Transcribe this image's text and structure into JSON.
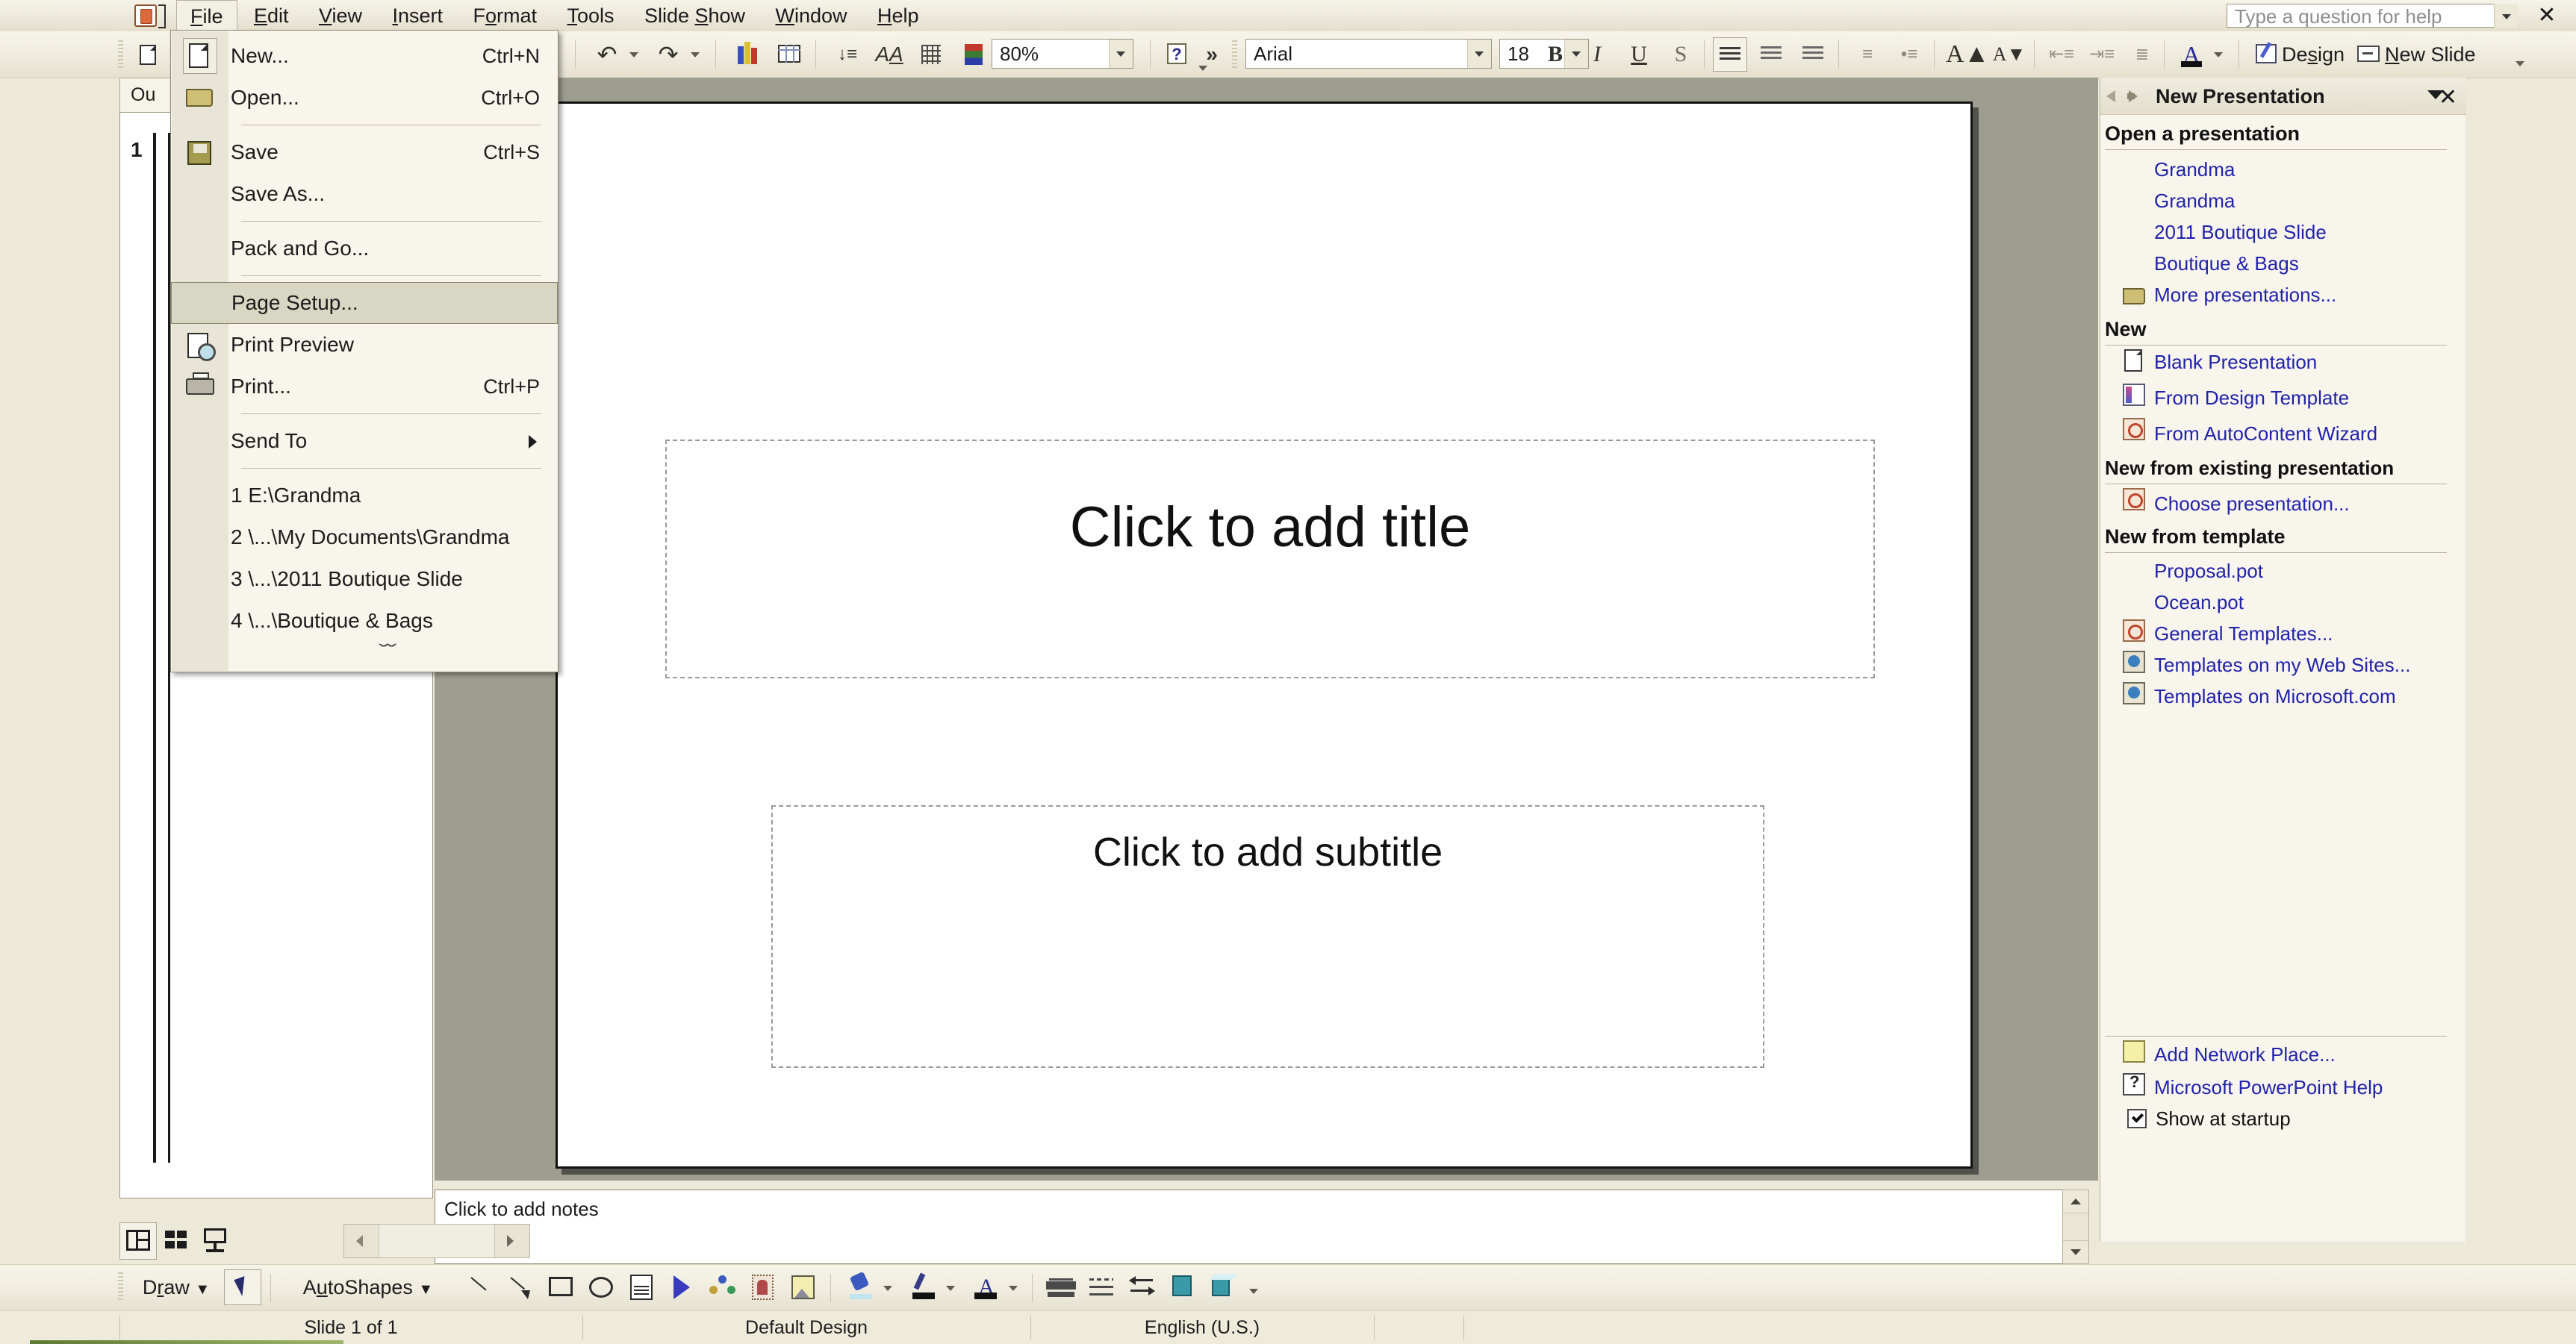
{
  "app": {
    "help_placeholder": "Type a question for help",
    "close_label": "✕"
  },
  "menubar": {
    "items": [
      {
        "label": "File",
        "accel": "F",
        "open": true
      },
      {
        "label": "Edit",
        "accel": "E",
        "open": false
      },
      {
        "label": "View",
        "accel": "V",
        "open": false
      },
      {
        "label": "Insert",
        "accel": "I",
        "open": false
      },
      {
        "label": "Format",
        "accel": "o",
        "open": false
      },
      {
        "label": "Tools",
        "accel": "T",
        "open": false
      },
      {
        "label": "Slide Show",
        "accel": "S",
        "open": false
      },
      {
        "label": "Window",
        "accel": "W",
        "open": false
      },
      {
        "label": "Help",
        "accel": "H",
        "open": false
      }
    ]
  },
  "file_menu": {
    "items": [
      {
        "label": "New...",
        "accel": "Ctrl+N",
        "icon": "new-document-icon",
        "type": "item"
      },
      {
        "label": "Open...",
        "accel": "Ctrl+O",
        "icon": "open-folder-icon",
        "type": "item"
      },
      {
        "type": "separator"
      },
      {
        "label": "Save",
        "accel": "Ctrl+S",
        "icon": "floppy-disk-icon",
        "type": "item"
      },
      {
        "label": "Save As...",
        "accel": "",
        "icon": "",
        "type": "item"
      },
      {
        "type": "separator"
      },
      {
        "label": "Pack and Go...",
        "accel": "",
        "icon": "",
        "type": "item"
      },
      {
        "type": "separator"
      },
      {
        "label": "Page Setup...",
        "accel": "",
        "icon": "",
        "type": "item",
        "highlighted": true
      },
      {
        "label": "Print Preview",
        "accel": "",
        "icon": "print-preview-icon",
        "type": "item"
      },
      {
        "label": "Print...",
        "accel": "Ctrl+P",
        "icon": "printer-icon",
        "type": "item"
      },
      {
        "type": "separator"
      },
      {
        "label": "Send To",
        "accel": "",
        "icon": "",
        "type": "submenu"
      },
      {
        "type": "separator"
      },
      {
        "label": "1 E:\\Grandma",
        "accel": "",
        "icon": "",
        "type": "item"
      },
      {
        "label": "2 \\...\\My Documents\\Grandma",
        "accel": "",
        "icon": "",
        "type": "item"
      },
      {
        "label": "3 \\...\\2011 Boutique Slide",
        "accel": "",
        "icon": "",
        "type": "item"
      },
      {
        "label": "4 \\...\\Boutique & Bags",
        "accel": "",
        "icon": "",
        "type": "item"
      }
    ],
    "expand_chevron": "ˇˇ"
  },
  "toolbar": {
    "zoom_value": "80%",
    "font_name": "Arial",
    "font_size": "18",
    "design_label": "Design",
    "new_slide_label": "New Slide",
    "overflow_label": "»",
    "buttons": [
      {
        "name": "new-button",
        "glyph": ""
      },
      {
        "name": "undo-button",
        "glyph": "↶"
      },
      {
        "name": "redo-button",
        "glyph": "↷"
      },
      {
        "name": "insert-chart-button",
        "glyph": ""
      },
      {
        "name": "insert-table-button",
        "glyph": ""
      },
      {
        "name": "expand-all-button",
        "glyph": ""
      },
      {
        "name": "show-formatting-button",
        "glyph": "A"
      },
      {
        "name": "show-grid-button",
        "glyph": ""
      },
      {
        "name": "color-grayscale-button",
        "glyph": ""
      },
      {
        "name": "help-button",
        "glyph": "?"
      },
      {
        "name": "bold-button",
        "glyph": "B"
      },
      {
        "name": "italic-button",
        "glyph": "I"
      },
      {
        "name": "underline-button",
        "glyph": "U"
      },
      {
        "name": "shadow-button",
        "glyph": "S"
      },
      {
        "name": "align-left-button",
        "glyph": ""
      },
      {
        "name": "align-center-button",
        "glyph": ""
      },
      {
        "name": "align-right-button",
        "glyph": ""
      },
      {
        "name": "numbered-list-button",
        "glyph": ""
      },
      {
        "name": "bulleted-list-button",
        "glyph": ""
      },
      {
        "name": "increase-font-size-button",
        "glyph": "A"
      },
      {
        "name": "decrease-font-size-button",
        "glyph": "A"
      },
      {
        "name": "decrease-indent-button",
        "glyph": ""
      },
      {
        "name": "increase-indent-button",
        "glyph": ""
      },
      {
        "name": "line-spacing-button",
        "glyph": ""
      },
      {
        "name": "font-color-button",
        "glyph": "A"
      }
    ]
  },
  "outline": {
    "tab_label": "Ou",
    "slide_number": "1"
  },
  "slide": {
    "title_placeholder": "Click to add title",
    "subtitle_placeholder": "Click to add subtitle"
  },
  "notes": {
    "placeholder": "Click to add notes"
  },
  "drawing_toolbar": {
    "draw_label": "Draw",
    "autoshapes_label": "AutoShapes",
    "buttons": [
      {
        "name": "select-objects-button"
      },
      {
        "name": "line-button"
      },
      {
        "name": "arrow-button"
      },
      {
        "name": "rectangle-button"
      },
      {
        "name": "oval-button"
      },
      {
        "name": "text-box-button"
      },
      {
        "name": "insert-wordart-button"
      },
      {
        "name": "insert-diagram-button"
      },
      {
        "name": "insert-clip-art-button"
      },
      {
        "name": "insert-picture-button"
      },
      {
        "name": "fill-color-button"
      },
      {
        "name": "line-color-button"
      },
      {
        "name": "font-color-button"
      },
      {
        "name": "line-style-button"
      },
      {
        "name": "dash-style-button"
      },
      {
        "name": "arrow-style-button"
      },
      {
        "name": "shadow-style-button"
      },
      {
        "name": "3d-style-button"
      }
    ]
  },
  "view_buttons": [
    {
      "name": "normal-view-button",
      "selected": true
    },
    {
      "name": "slide-sorter-view-button",
      "selected": false
    },
    {
      "name": "slide-show-view-button",
      "selected": false
    }
  ],
  "status_bar": {
    "slide_counter": "Slide 1 of 1",
    "design_name": "Default Design",
    "language": "English (U.S.)"
  },
  "task_pane": {
    "title": "New Presentation",
    "close_label": "✕",
    "sections": [
      {
        "heading": "Open a presentation",
        "links": [
          {
            "label": "Grandma",
            "icon": ""
          },
          {
            "label": "Grandma",
            "icon": ""
          },
          {
            "label": "2011 Boutique Slide",
            "icon": ""
          },
          {
            "label": "Boutique & Bags",
            "icon": ""
          },
          {
            "label": "More presentations...",
            "icon": "open-folder-icon"
          }
        ]
      },
      {
        "heading": "New",
        "links": [
          {
            "label": "Blank Presentation",
            "icon": "blank-page-icon"
          },
          {
            "label": "From Design Template",
            "icon": "design-template-icon"
          },
          {
            "label": "From AutoContent Wizard",
            "icon": "autocontent-wizard-icon"
          }
        ]
      },
      {
        "heading": "New from existing presentation",
        "links": [
          {
            "label": "Choose presentation...",
            "icon": "choose-presentation-icon"
          }
        ]
      },
      {
        "heading": "New from template",
        "links": [
          {
            "label": "Proposal.pot",
            "icon": ""
          },
          {
            "label": "Ocean.pot",
            "icon": ""
          },
          {
            "label": "General Templates...",
            "icon": "general-templates-icon"
          },
          {
            "label": "Templates on my Web Sites...",
            "icon": "web-templates-icon"
          },
          {
            "label": "Templates on Microsoft.com",
            "icon": "microsoft-templates-icon"
          }
        ]
      }
    ],
    "footer": {
      "links": [
        {
          "label": "Add Network Place...",
          "icon": "add-network-place-icon"
        },
        {
          "label": "Microsoft PowerPoint Help",
          "icon": "help-icon"
        }
      ],
      "checkbox_label": "Show at startup",
      "checkbox_checked": true
    }
  },
  "colors": {
    "chrome": "#ece9d8",
    "toolbar_light": "#f7f5ea",
    "link": "#2222aa",
    "highlight": "#d7d7c4",
    "slide_bg_surround": "#9e9e90",
    "status_green": "#5f7a33"
  }
}
